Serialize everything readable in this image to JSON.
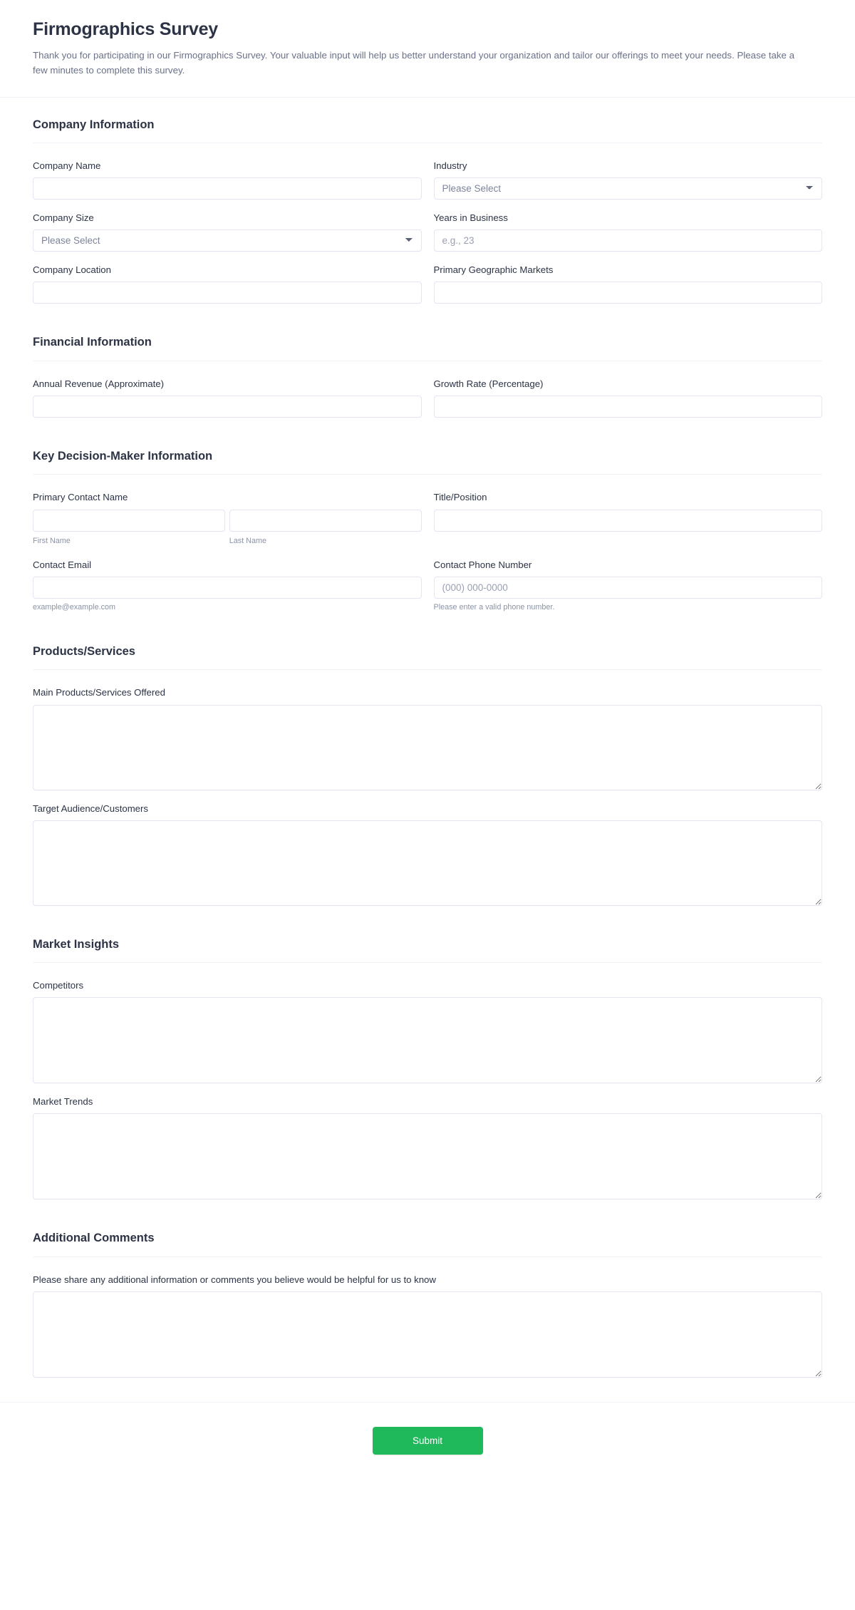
{
  "header": {
    "title": "Firmographics Survey",
    "description": "Thank you for participating in our Firmographics Survey. Your valuable input will help us better understand your organization and tailor our offerings to meet your needs. Please take a few minutes to complete this survey."
  },
  "sections": {
    "company": {
      "title": "Company Information",
      "company_name_label": "Company Name",
      "company_name_value": "",
      "industry_label": "Industry",
      "industry_selected": "Please Select",
      "company_size_label": "Company Size",
      "company_size_selected": "Please Select",
      "years_label": "Years in Business",
      "years_placeholder": "e.g., 23",
      "years_value": "",
      "location_label": "Company Location",
      "location_value": "",
      "markets_label": "Primary Geographic Markets",
      "markets_value": ""
    },
    "financial": {
      "title": "Financial Information",
      "revenue_label": "Annual Revenue (Approximate)",
      "revenue_value": "",
      "growth_label": "Growth Rate (Percentage)",
      "growth_value": ""
    },
    "decision_maker": {
      "title": "Key Decision-Maker Information",
      "contact_name_label": "Primary Contact Name",
      "first_name_value": "",
      "first_name_hint": "First Name",
      "last_name_value": "",
      "last_name_hint": "Last Name",
      "title_position_label": "Title/Position",
      "title_position_value": "",
      "email_label": "Contact Email",
      "email_value": "",
      "email_hint": "example@example.com",
      "phone_label": "Contact Phone Number",
      "phone_placeholder": "(000) 000-0000",
      "phone_value": "",
      "phone_hint": "Please enter a valid phone number."
    },
    "products": {
      "title": "Products/Services",
      "main_products_label": "Main Products/Services Offered",
      "main_products_value": "",
      "target_audience_label": "Target Audience/Customers",
      "target_audience_value": ""
    },
    "market": {
      "title": "Market Insights",
      "competitors_label": "Competitors",
      "competitors_value": "",
      "trends_label": "Market Trends",
      "trends_value": ""
    },
    "additional": {
      "title": "Additional Comments",
      "comments_label": "Please share any additional information or comments you believe would be helpful for us to know",
      "comments_value": ""
    }
  },
  "footer": {
    "submit_label": "Submit"
  },
  "colors": {
    "submit_green": "#1fb85a",
    "title_text": "#2c3345",
    "muted_text": "#6a7189",
    "border": "#e3e5f0",
    "divider": "#f2f2f8"
  }
}
